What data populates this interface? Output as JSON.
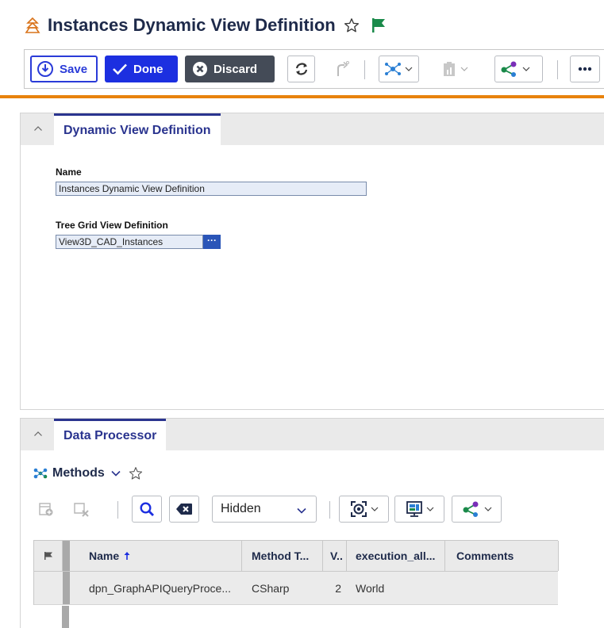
{
  "header": {
    "title": "Instances Dynamic View Definition",
    "title_icon": "stacked-boxes-icon",
    "accent_color": "#e8820c"
  },
  "toolbar": {
    "save_label": "Save",
    "done_label": "Done",
    "discard_label": "Discard",
    "primary_color": "#1c2fe0"
  },
  "panel1": {
    "tab_label": "Dynamic View Definition",
    "name_label": "Name",
    "name_value": "Instances Dynamic View Definition",
    "tree_label": "Tree Grid View Definition",
    "tree_value": "View3D_CAD_Instances",
    "ellipsis": "···"
  },
  "panel2": {
    "tab_label": "Data Processor",
    "methods_title": "Methods",
    "filter_select": "Hidden"
  },
  "grid": {
    "columns": [
      "Name",
      "Method T...",
      "V..",
      "execution_all...",
      "Comments"
    ],
    "rows": [
      {
        "name": "dpn_GraphAPIQueryProce...",
        "method_type": "CSharp",
        "version": "2",
        "execution": "World",
        "comments": ""
      }
    ]
  }
}
